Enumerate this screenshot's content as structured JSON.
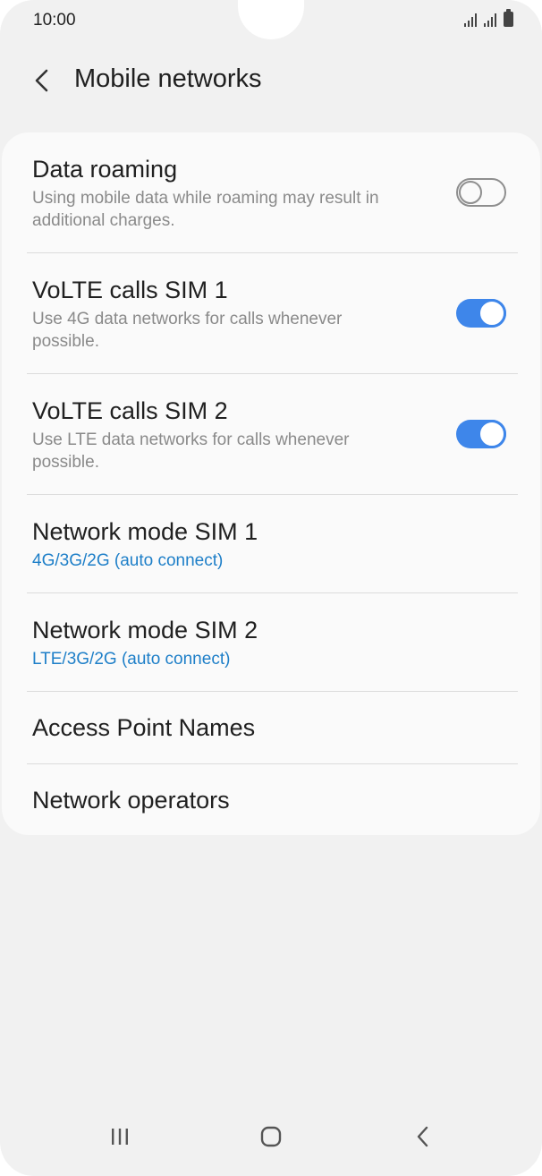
{
  "status_bar": {
    "time": "10:00"
  },
  "header": {
    "title": "Mobile networks"
  },
  "settings": [
    {
      "title": "Data roaming",
      "subtitle": "Using mobile data while roaming may result in additional charges.",
      "toggle": "off"
    },
    {
      "title": "VoLTE calls SIM 1",
      "subtitle": "Use 4G data networks for calls whenever possible.",
      "toggle": "on"
    },
    {
      "title": "VoLTE calls SIM 2",
      "subtitle": "Use LTE data networks for calls whenever possible.",
      "toggle": "on"
    },
    {
      "title": "Network mode SIM 1",
      "value": "4G/3G/2G (auto connect)"
    },
    {
      "title": "Network mode SIM 2",
      "value": "LTE/3G/2G (auto connect)"
    },
    {
      "title": "Access Point Names"
    },
    {
      "title": "Network operators"
    }
  ],
  "icons": {
    "back": "chevron-left-icon",
    "signal_1": "signal-icon",
    "signal_2": "signal-icon",
    "battery": "battery-icon",
    "nav_recents": "recents-icon",
    "nav_home": "home-icon",
    "nav_back": "back-icon"
  },
  "colors": {
    "accent": "#3e86ea",
    "value_text": "#1e7fc8",
    "background": "#f1f1f1",
    "card": "#fafafa"
  }
}
